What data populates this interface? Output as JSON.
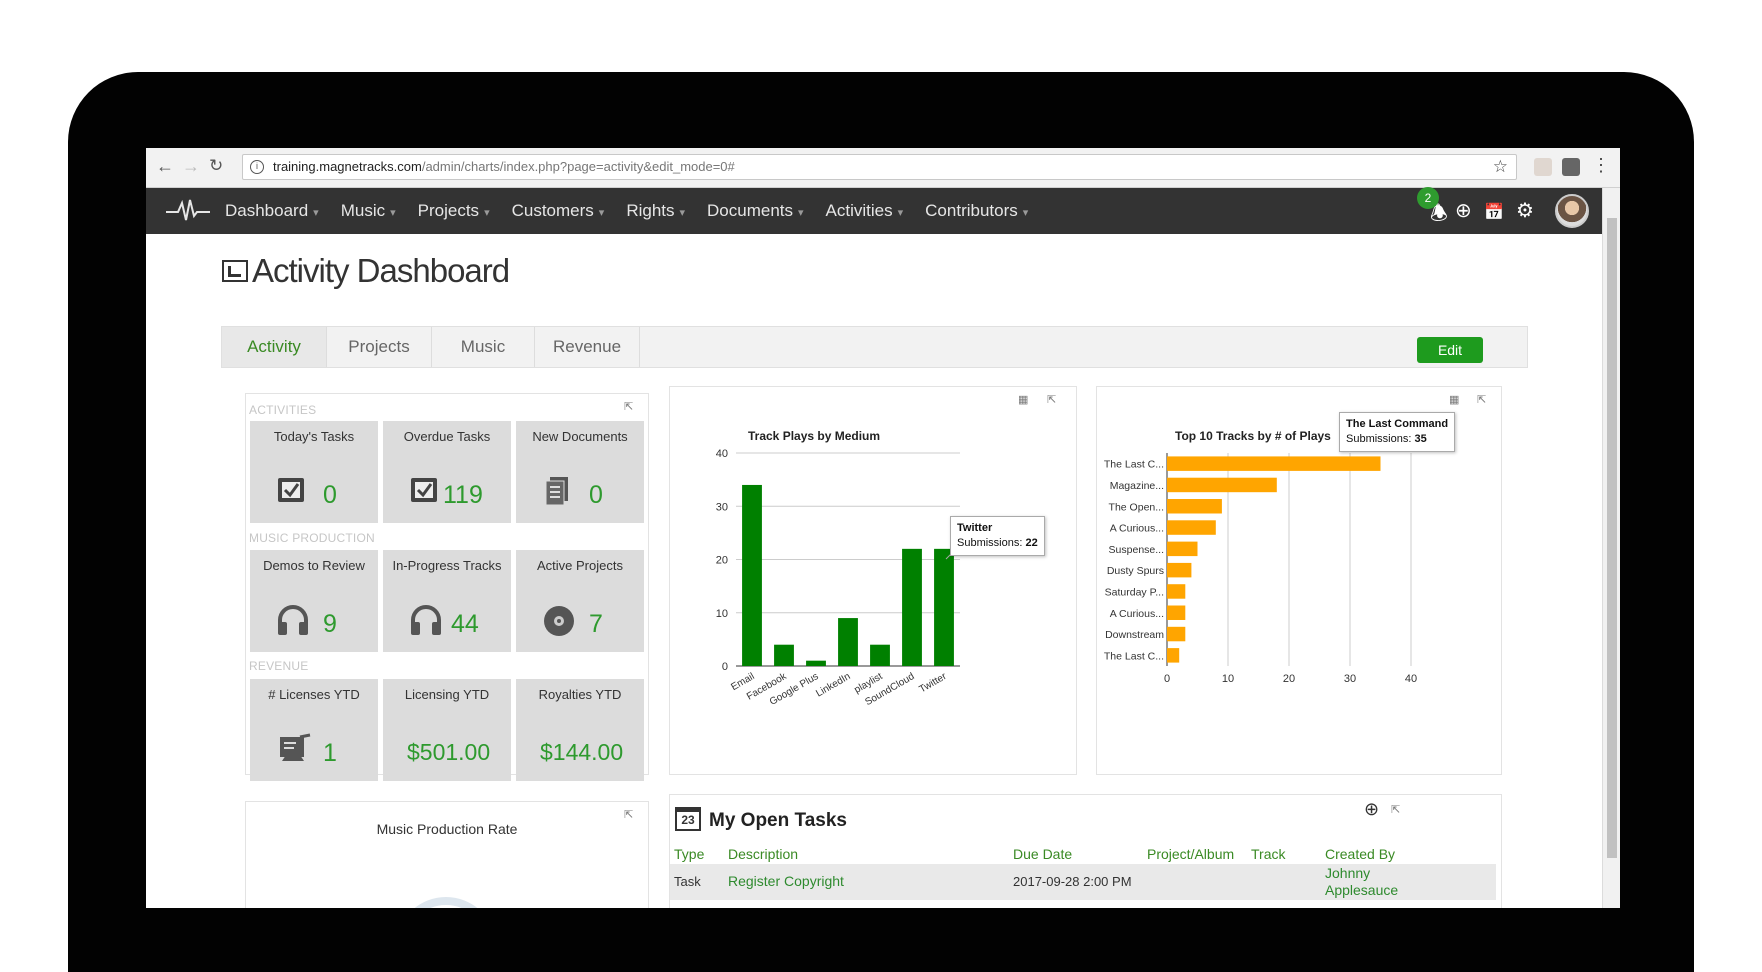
{
  "browser": {
    "url_host": "training.magnetracks.com",
    "url_path": "/admin/charts/index.php?page=activity&edit_mode=0#"
  },
  "nav": {
    "items": [
      "Dashboard",
      "Music",
      "Projects",
      "Customers",
      "Rights",
      "Documents",
      "Activities",
      "Contributors"
    ],
    "notification_count": "2"
  },
  "page": {
    "title": "Activity Dashboard"
  },
  "tabs": [
    "Activity",
    "Projects",
    "Music",
    "Revenue"
  ],
  "edit_label": "Edit",
  "kpi": {
    "sections": {
      "activities": "ACTIVITIES",
      "music_production": "MUSIC PRODUCTION",
      "revenue": "REVENUE"
    },
    "tiles": [
      {
        "title": "Today's Tasks",
        "value": "0",
        "icon": "task-check-icon"
      },
      {
        "title": "Overdue Tasks",
        "value": "119",
        "icon": "task-check-icon"
      },
      {
        "title": "New Documents",
        "value": "0",
        "icon": "documents-icon"
      },
      {
        "title": "Demos to Review",
        "value": "9",
        "icon": "headphones-icon"
      },
      {
        "title": "In-Progress Tracks",
        "value": "44",
        "icon": "headphones-icon"
      },
      {
        "title": "Active Projects",
        "value": "7",
        "icon": "disc-icon"
      },
      {
        "title": "# Licenses YTD",
        "value": "1",
        "icon": "license-icon"
      },
      {
        "title": "Licensing YTD",
        "value": "$501.00",
        "icon": ""
      },
      {
        "title": "Royalties YTD",
        "value": "$144.00",
        "icon": ""
      }
    ]
  },
  "production_rate": {
    "title": "Music Production Rate"
  },
  "chart_data": [
    {
      "type": "bar",
      "title": "Track Plays by Medium",
      "categories": [
        "Email",
        "Facebook",
        "Google Plus",
        "LinkedIn",
        "playlist",
        "SoundCloud",
        "Twitter"
      ],
      "values": [
        34,
        4,
        1,
        9,
        4,
        22,
        22
      ],
      "ylim": [
        0,
        40
      ],
      "yticks": [
        0,
        10,
        20,
        30,
        40
      ],
      "color": "#008000",
      "tooltip": {
        "label": "Twitter",
        "series_label": "Submissions:",
        "value": "22"
      }
    },
    {
      "type": "bar",
      "orientation": "horizontal",
      "title": "Top 10 Tracks by # of Plays",
      "categories": [
        "The Last C...",
        "Magazine...",
        "The Open...",
        "A Curious...",
        "Suspense...",
        "Dusty Spurs",
        "Saturday P...",
        "A Curious...",
        "Downstream",
        "The Last C..."
      ],
      "values": [
        35,
        18,
        9,
        8,
        5,
        4,
        3,
        3,
        3,
        2
      ],
      "xlim": [
        0,
        40
      ],
      "xticks": [
        0,
        10,
        20,
        30,
        40
      ],
      "color": "#ffa500",
      "tooltip": {
        "label": "The Last Command",
        "series_label": "Submissions:",
        "value": "35"
      }
    }
  ],
  "tasks": {
    "title": "My Open Tasks",
    "calendar_day": "23",
    "columns": [
      "Type",
      "Description",
      "Due Date",
      "Project/Album",
      "Track",
      "Created By"
    ],
    "rows": [
      {
        "type": "Task",
        "description": "Register Copyright",
        "due": "2017-09-28 2:00 PM",
        "project": "",
        "track": "",
        "created_by_1": "Johnny",
        "created_by_2": "Applesauce"
      }
    ]
  }
}
